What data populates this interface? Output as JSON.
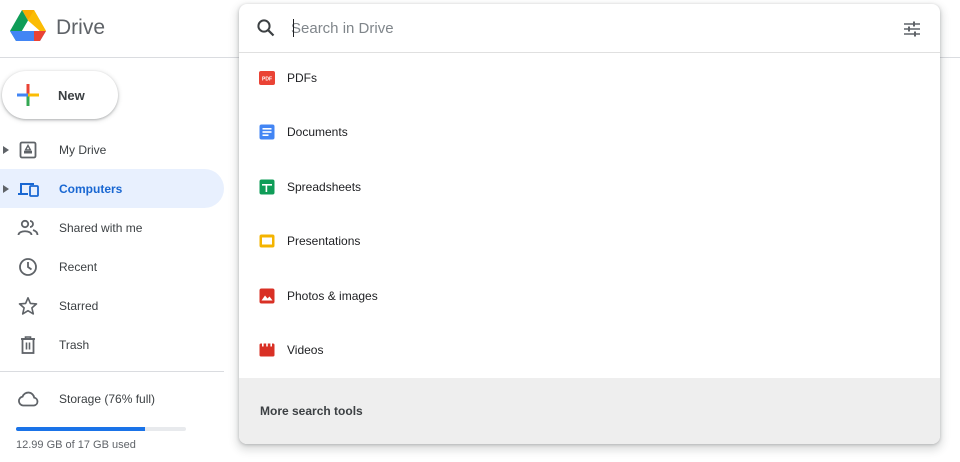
{
  "app": {
    "brand": "Drive"
  },
  "sidebar": {
    "new_label": "New",
    "items": [
      {
        "label": "My Drive",
        "icon": "my-drive-icon",
        "active": false,
        "expandable": true
      },
      {
        "label": "Computers",
        "icon": "computers-icon",
        "active": true,
        "expandable": true
      },
      {
        "label": "Shared with me",
        "icon": "shared-icon",
        "active": false,
        "expandable": false
      },
      {
        "label": "Recent",
        "icon": "clock-icon",
        "active": false,
        "expandable": false
      },
      {
        "label": "Starred",
        "icon": "star-icon",
        "active": false,
        "expandable": false
      },
      {
        "label": "Trash",
        "icon": "trash-icon",
        "active": false,
        "expandable": false
      }
    ],
    "storage": {
      "label": "Storage (76% full)",
      "usage_text": "12.99 GB of 17 GB used",
      "fraction": 0.76
    }
  },
  "search": {
    "placeholder": "Search in Drive",
    "options": [
      {
        "label": "PDFs",
        "icon": "pdf-icon",
        "color": "#ea4335"
      },
      {
        "label": "Documents",
        "icon": "document-icon",
        "color": "#4285f4"
      },
      {
        "label": "Spreadsheets",
        "icon": "spreadsheet-icon",
        "color": "#0f9d58"
      },
      {
        "label": "Presentations",
        "icon": "presentation-icon",
        "color": "#f4b400"
      },
      {
        "label": "Photos & images",
        "icon": "image-icon",
        "color": "#d93025"
      },
      {
        "label": "Videos",
        "icon": "video-icon",
        "color": "#d93025"
      }
    ],
    "more_label": "More search tools"
  },
  "colors": {
    "accent": "#1a73e8",
    "active_bg": "#e8f0fe",
    "active_text": "#1967d2"
  }
}
